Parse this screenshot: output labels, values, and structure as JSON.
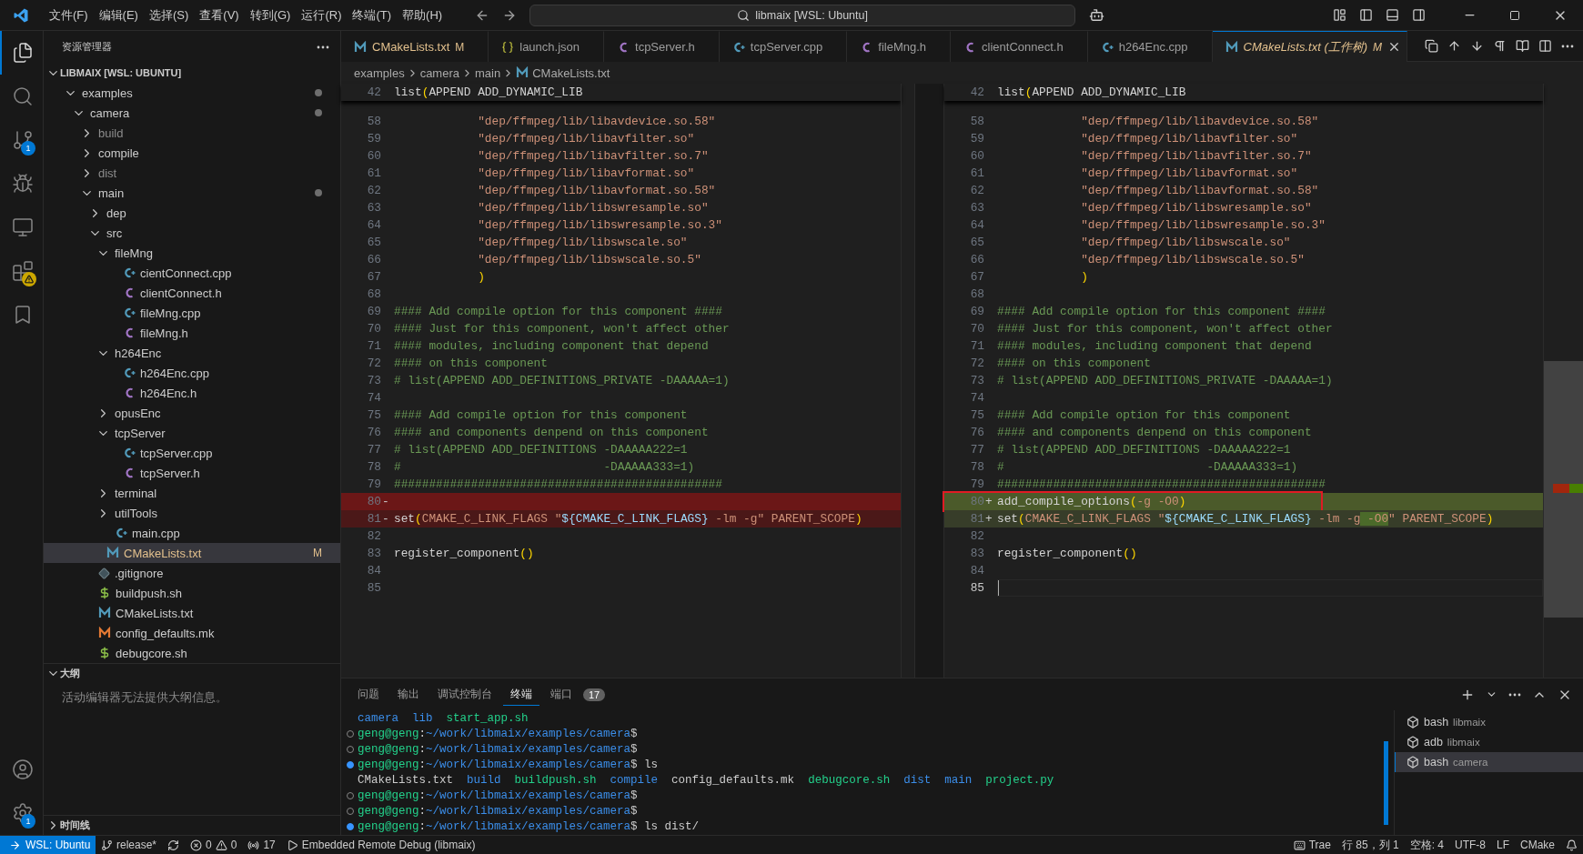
{
  "title_bar": {
    "menus": [
      "文件(F)",
      "编辑(E)",
      "选择(S)",
      "查看(V)",
      "转到(G)",
      "运行(R)",
      "终端(T)",
      "帮助(H)"
    ],
    "search": "libmaix [WSL: Ubuntu]"
  },
  "activity_bar": {
    "top": [
      {
        "selected": true
      },
      {
        "selected": false
      },
      {
        "selected": false,
        "badge": "1"
      },
      {
        "selected": false
      },
      {
        "selected": false
      },
      {
        "selected": false,
        "warning": true
      },
      {
        "selected": false
      }
    ],
    "bottom": [
      {
        "selected": false
      },
      {
        "selected": false,
        "badge": "1"
      }
    ]
  },
  "sidebar": {
    "title": "资源管理器",
    "root": "LIBMAIX [WSL: UBUNTU]",
    "root_expanded": true,
    "tree": [
      {
        "label": "examples",
        "kind": "folder",
        "expanded": true,
        "modified": true,
        "dimmed": false,
        "selected": false,
        "children": [
          {
            "label": "camera",
            "kind": "folder",
            "expanded": true,
            "modified": true,
            "dimmed": false,
            "selected": false,
            "children": [
              {
                "label": "build",
                "kind": "folder",
                "expanded": false,
                "modified": false,
                "dimmed": true,
                "selected": false
              },
              {
                "label": "compile",
                "kind": "folder",
                "expanded": false,
                "modified": false,
                "dimmed": false,
                "selected": false
              },
              {
                "label": "dist",
                "kind": "folder",
                "expanded": false,
                "modified": false,
                "dimmed": true,
                "selected": false
              },
              {
                "label": "main",
                "kind": "folder",
                "expanded": true,
                "modified": true,
                "dimmed": false,
                "selected": false,
                "children": [
                  {
                    "label": "dep",
                    "kind": "folder",
                    "expanded": false,
                    "modified": false,
                    "dimmed": false,
                    "selected": false
                  },
                  {
                    "label": "src",
                    "kind": "folder",
                    "expanded": true,
                    "modified": false,
                    "dimmed": false,
                    "selected": false,
                    "children": [
                      {
                        "label": "fileMng",
                        "kind": "folder",
                        "expanded": true,
                        "modified": false,
                        "dimmed": false,
                        "selected": false,
                        "children": [
                          {
                            "label": "cientConnect.cpp",
                            "kind": "cpp",
                            "modified": false,
                            "dimmed": false,
                            "selected": false
                          },
                          {
                            "label": "clientConnect.h",
                            "kind": "h",
                            "modified": false,
                            "dimmed": false,
                            "selected": false
                          },
                          {
                            "label": "fileMng.cpp",
                            "kind": "cpp",
                            "modified": false,
                            "dimmed": false,
                            "selected": false
                          },
                          {
                            "label": "fileMng.h",
                            "kind": "h",
                            "modified": false,
                            "dimmed": false,
                            "selected": false
                          }
                        ]
                      },
                      {
                        "label": "h264Enc",
                        "kind": "folder",
                        "expanded": true,
                        "modified": false,
                        "dimmed": false,
                        "selected": false,
                        "children": [
                          {
                            "label": "h264Enc.cpp",
                            "kind": "cpp",
                            "modified": false,
                            "dimmed": false,
                            "selected": false
                          },
                          {
                            "label": "h264Enc.h",
                            "kind": "h",
                            "modified": false,
                            "dimmed": false,
                            "selected": false
                          }
                        ]
                      },
                      {
                        "label": "opusEnc",
                        "kind": "folder",
                        "expanded": false,
                        "modified": false,
                        "dimmed": false,
                        "selected": false
                      },
                      {
                        "label": "tcpServer",
                        "kind": "folder",
                        "expanded": true,
                        "modified": false,
                        "dimmed": false,
                        "selected": false,
                        "children": [
                          {
                            "label": "tcpServer.cpp",
                            "kind": "cpp",
                            "modified": false,
                            "dimmed": false,
                            "selected": false
                          },
                          {
                            "label": "tcpServer.h",
                            "kind": "h",
                            "modified": false,
                            "dimmed": false,
                            "selected": false
                          }
                        ]
                      },
                      {
                        "label": "terminal",
                        "kind": "folder",
                        "expanded": false,
                        "modified": false,
                        "dimmed": false,
                        "selected": false
                      },
                      {
                        "label": "utilTools",
                        "kind": "folder",
                        "expanded": false,
                        "modified": false,
                        "dimmed": false,
                        "selected": false
                      },
                      {
                        "label": "main.cpp",
                        "kind": "cpp",
                        "modified": false,
                        "dimmed": false,
                        "selected": false
                      }
                    ]
                  },
                  {
                    "label": "CMakeLists.txt",
                    "kind": "cmake",
                    "modified": true,
                    "badge": "M",
                    "dimmed": false,
                    "selected": true
                  }
                ]
              },
              {
                "label": ".gitignore",
                "kind": "git",
                "modified": false,
                "dimmed": false,
                "selected": false
              },
              {
                "label": "buildpush.sh",
                "kind": "sh",
                "modified": false,
                "dimmed": false,
                "selected": false
              },
              {
                "label": "CMakeLists.txt",
                "kind": "cmake",
                "modified": false,
                "dimmed": false,
                "selected": false
              },
              {
                "label": "config_defaults.mk",
                "kind": "mk",
                "modified": false,
                "dimmed": false,
                "selected": false
              },
              {
                "label": "debugcore.sh",
                "kind": "sh",
                "modified": false,
                "dimmed": false,
                "selected": false
              }
            ]
          }
        ]
      }
    ],
    "outline": {
      "title": "大纲",
      "expanded": true,
      "message": "活动编辑器无法提供大纲信息。"
    },
    "timeline": {
      "title": "时间线",
      "expanded": false
    }
  },
  "tabs": [
    {
      "label": "CMakeLists.txt",
      "kind": "cmake",
      "modified": true,
      "badge": "M",
      "selected": false,
      "preview": false
    },
    {
      "label": "launch.json",
      "kind": "json",
      "modified": false,
      "selected": false,
      "preview": false
    },
    {
      "label": "tcpServer.h",
      "kind": "h",
      "modified": false,
      "selected": false,
      "preview": false
    },
    {
      "label": "tcpServer.cpp",
      "kind": "cpp",
      "modified": false,
      "selected": false,
      "preview": false
    },
    {
      "label": "fileMng.h",
      "kind": "h",
      "modified": false,
      "selected": false,
      "preview": false
    },
    {
      "label": "clientConnect.h",
      "kind": "h",
      "modified": false,
      "selected": false,
      "preview": false
    },
    {
      "label": "h264Enc.cpp",
      "kind": "cpp",
      "modified": false,
      "selected": false,
      "preview": false
    },
    {
      "label": "CMakeLists.txt (工作树)",
      "kind": "cmake",
      "modified": true,
      "badge": "M",
      "selected": true,
      "preview": true
    }
  ],
  "breadcrumb": [
    "examples",
    "camera",
    "main",
    "CMakeLists.txt"
  ],
  "diff": {
    "panes": [
      {
        "sticky": {
          "n": "42",
          "segs": [
            {
              "text": "list",
              "kind": "func"
            },
            {
              "text": "(",
              "kind": "paren"
            },
            {
              "text": "APPEND ADD_DYNAMIC_LIB",
              "kind": "plain"
            }
          ]
        },
        "lines": [
          {
            "n": "58",
            "kind": "unchanged",
            "segs": [
              {
                "text": "            \"dep/ffmpeg/lib/libavdevice.so.58\"",
                "kind": "string"
              }
            ]
          },
          {
            "n": "59",
            "kind": "unchanged",
            "segs": [
              {
                "text": "            \"dep/ffmpeg/lib/libavfilter.so\"",
                "kind": "string"
              }
            ]
          },
          {
            "n": "60",
            "kind": "unchanged",
            "segs": [
              {
                "text": "            \"dep/ffmpeg/lib/libavfilter.so.7\"",
                "kind": "string"
              }
            ]
          },
          {
            "n": "61",
            "kind": "unchanged",
            "segs": [
              {
                "text": "            \"dep/ffmpeg/lib/libavformat.so\"",
                "kind": "string"
              }
            ]
          },
          {
            "n": "62",
            "kind": "unchanged",
            "segs": [
              {
                "text": "            \"dep/ffmpeg/lib/libavformat.so.58\"",
                "kind": "string"
              }
            ]
          },
          {
            "n": "63",
            "kind": "unchanged",
            "segs": [
              {
                "text": "            \"dep/ffmpeg/lib/libswresample.so\"",
                "kind": "string"
              }
            ]
          },
          {
            "n": "64",
            "kind": "unchanged",
            "segs": [
              {
                "text": "            \"dep/ffmpeg/lib/libswresample.so.3\"",
                "kind": "string"
              }
            ]
          },
          {
            "n": "65",
            "kind": "unchanged",
            "segs": [
              {
                "text": "            \"dep/ffmpeg/lib/libswscale.so\"",
                "kind": "string"
              }
            ]
          },
          {
            "n": "66",
            "kind": "unchanged",
            "segs": [
              {
                "text": "            \"dep/ffmpeg/lib/libswscale.so.5\"",
                "kind": "string"
              }
            ]
          },
          {
            "n": "67",
            "kind": "unchanged",
            "segs": [
              {
                "text": "            )",
                "kind": "paren"
              }
            ]
          },
          {
            "n": "68",
            "kind": "unchanged"
          },
          {
            "n": "69",
            "kind": "unchanged",
            "segs": [
              {
                "text": "#### Add compile option for this component ####",
                "kind": "comment"
              }
            ]
          },
          {
            "n": "70",
            "kind": "unchanged",
            "segs": [
              {
                "text": "#### Just for this component, won't affect other",
                "kind": "comment"
              }
            ]
          },
          {
            "n": "71",
            "kind": "unchanged",
            "segs": [
              {
                "text": "#### modules, including component that depend",
                "kind": "comment"
              }
            ]
          },
          {
            "n": "72",
            "kind": "unchanged",
            "segs": [
              {
                "text": "#### on this component",
                "kind": "comment"
              }
            ]
          },
          {
            "n": "73",
            "kind": "unchanged",
            "segs": [
              {
                "text": "# list(APPEND ADD_DEFINITIONS_PRIVATE -DAAAAA=1)",
                "kind": "comment"
              }
            ]
          },
          {
            "n": "74",
            "kind": "unchanged"
          },
          {
            "n": "75",
            "kind": "unchanged",
            "segs": [
              {
                "text": "#### Add compile option for this component",
                "kind": "comment"
              }
            ]
          },
          {
            "n": "76",
            "kind": "unchanged",
            "segs": [
              {
                "text": "#### and components denpend on this component",
                "kind": "comment"
              }
            ]
          },
          {
            "n": "77",
            "kind": "unchanged",
            "segs": [
              {
                "text": "# list(APPEND ADD_DEFINITIONS -DAAAAA222=1",
                "kind": "comment"
              }
            ]
          },
          {
            "n": "78",
            "kind": "unchanged",
            "segs": [
              {
                "text": "#                             -DAAAAA333=1)",
                "kind": "comment"
              }
            ]
          },
          {
            "n": "79",
            "kind": "unchanged",
            "segs": [
              {
                "text": "###############################################",
                "kind": "comment"
              }
            ]
          },
          {
            "n": "80",
            "kind": "removed",
            "marker": "-"
          },
          {
            "n": "81",
            "kind": "modified",
            "marker": "-",
            "segs": [
              {
                "text": "set",
                "kind": "func"
              },
              {
                "text": "(",
                "kind": "paren"
              },
              {
                "text": "CMAKE_C_LINK_FLAGS ",
                "kind": "const"
              },
              {
                "text": "\"",
                "kind": "string"
              },
              {
                "text": "${CMAKE_C_LINK_FLAGS}",
                "kind": "var"
              },
              {
                "text": " -lm -g",
                "kind": "string"
              },
              {
                "text": "\"",
                "kind": "string"
              },
              {
                "text": " PARENT_SCOPE",
                "kind": "const"
              },
              {
                "text": ")",
                "kind": "paren"
              }
            ]
          },
          {
            "n": "82",
            "kind": "unchanged"
          },
          {
            "n": "83",
            "kind": "unchanged",
            "segs": [
              {
                "text": "register_component",
                "kind": "func"
              },
              {
                "text": "()",
                "kind": "paren"
              }
            ]
          },
          {
            "n": "84",
            "kind": "unchanged"
          },
          {
            "n": "85",
            "kind": "unchanged"
          }
        ]
      },
      {
        "sticky": {
          "n": "42",
          "segs": [
            {
              "text": "list",
              "kind": "func"
            },
            {
              "text": "(",
              "kind": "paren"
            },
            {
              "text": "APPEND ADD_DYNAMIC_LIB",
              "kind": "plain"
            }
          ]
        },
        "lines": [
          {
            "n": "58",
            "kind": "unchanged",
            "boxed": false,
            "cursor": false,
            "segs": [
              {
                "text": "            \"dep/ffmpeg/lib/libavdevice.so.58\"",
                "kind": "string"
              }
            ]
          },
          {
            "n": "59",
            "kind": "unchanged",
            "boxed": false,
            "cursor": false,
            "segs": [
              {
                "text": "            \"dep/ffmpeg/lib/libavfilter.so\"",
                "kind": "string"
              }
            ]
          },
          {
            "n": "60",
            "kind": "unchanged",
            "boxed": false,
            "cursor": false,
            "segs": [
              {
                "text": "            \"dep/ffmpeg/lib/libavfilter.so.7\"",
                "kind": "string"
              }
            ]
          },
          {
            "n": "61",
            "kind": "unchanged",
            "boxed": false,
            "cursor": false,
            "segs": [
              {
                "text": "            \"dep/ffmpeg/lib/libavformat.so\"",
                "kind": "string"
              }
            ]
          },
          {
            "n": "62",
            "kind": "unchanged",
            "boxed": false,
            "cursor": false,
            "segs": [
              {
                "text": "            \"dep/ffmpeg/lib/libavformat.so.58\"",
                "kind": "string"
              }
            ]
          },
          {
            "n": "63",
            "kind": "unchanged",
            "boxed": false,
            "cursor": false,
            "segs": [
              {
                "text": "            \"dep/ffmpeg/lib/libswresample.so\"",
                "kind": "string"
              }
            ]
          },
          {
            "n": "64",
            "kind": "unchanged",
            "boxed": false,
            "cursor": false,
            "segs": [
              {
                "text": "            \"dep/ffmpeg/lib/libswresample.so.3\"",
                "kind": "string"
              }
            ]
          },
          {
            "n": "65",
            "kind": "unchanged",
            "boxed": false,
            "cursor": false,
            "segs": [
              {
                "text": "            \"dep/ffmpeg/lib/libswscale.so\"",
                "kind": "string"
              }
            ]
          },
          {
            "n": "66",
            "kind": "unchanged",
            "boxed": false,
            "cursor": false,
            "segs": [
              {
                "text": "            \"dep/ffmpeg/lib/libswscale.so.5\"",
                "kind": "string"
              }
            ]
          },
          {
            "n": "67",
            "kind": "unchanged",
            "boxed": false,
            "cursor": false,
            "segs": [
              {
                "text": "            )",
                "kind": "paren"
              }
            ]
          },
          {
            "n": "68",
            "kind": "unchanged",
            "boxed": false,
            "cursor": false
          },
          {
            "n": "69",
            "kind": "unchanged",
            "boxed": false,
            "cursor": false,
            "segs": [
              {
                "text": "#### Add compile option for this component ####",
                "kind": "comment"
              }
            ]
          },
          {
            "n": "70",
            "kind": "unchanged",
            "boxed": false,
            "cursor": false,
            "segs": [
              {
                "text": "#### Just for this component, won't affect other",
                "kind": "comment"
              }
            ]
          },
          {
            "n": "71",
            "kind": "unchanged",
            "boxed": false,
            "cursor": false,
            "segs": [
              {
                "text": "#### modules, including component that depend",
                "kind": "comment"
              }
            ]
          },
          {
            "n": "72",
            "kind": "unchanged",
            "boxed": false,
            "cursor": false,
            "segs": [
              {
                "text": "#### on this component",
                "kind": "comment"
              }
            ]
          },
          {
            "n": "73",
            "kind": "unchanged",
            "boxed": false,
            "cursor": false,
            "segs": [
              {
                "text": "# list(APPEND ADD_DEFINITIONS_PRIVATE -DAAAAA=1)",
                "kind": "comment"
              }
            ]
          },
          {
            "n": "74",
            "kind": "unchanged",
            "boxed": false,
            "cursor": false
          },
          {
            "n": "75",
            "kind": "unchanged",
            "boxed": false,
            "cursor": false,
            "segs": [
              {
                "text": "#### Add compile option for this component",
                "kind": "comment"
              }
            ]
          },
          {
            "n": "76",
            "kind": "unchanged",
            "boxed": false,
            "cursor": false,
            "segs": [
              {
                "text": "#### and components denpend on this component",
                "kind": "comment"
              }
            ]
          },
          {
            "n": "77",
            "kind": "unchanged",
            "boxed": false,
            "cursor": false,
            "segs": [
              {
                "text": "# list(APPEND ADD_DEFINITIONS -DAAAAA222=1",
                "kind": "comment"
              }
            ]
          },
          {
            "n": "78",
            "kind": "unchanged",
            "boxed": false,
            "cursor": false,
            "segs": [
              {
                "text": "#                             -DAAAAA333=1)",
                "kind": "comment"
              }
            ]
          },
          {
            "n": "79",
            "kind": "unchanged",
            "boxed": false,
            "cursor": false,
            "segs": [
              {
                "text": "###############################################",
                "kind": "comment"
              }
            ]
          },
          {
            "n": "80",
            "kind": "added",
            "boxed": true,
            "cursor": false,
            "marker": "+",
            "segs": [
              {
                "text": "add_compile_options",
                "kind": "func"
              },
              {
                "text": "(",
                "kind": "paren"
              },
              {
                "text": "-g -O0",
                "kind": "const"
              },
              {
                "text": ")",
                "kind": "paren"
              }
            ]
          },
          {
            "n": "81",
            "kind": "modified",
            "boxed": false,
            "cursor": false,
            "marker": "+",
            "segs": [
              {
                "text": "set",
                "kind": "func"
              },
              {
                "text": "(",
                "kind": "paren"
              },
              {
                "text": "CMAKE_C_LINK_FLAGS ",
                "kind": "const"
              },
              {
                "text": "\"",
                "kind": "string"
              },
              {
                "text": "${CMAKE_C_LINK_FLAGS}",
                "kind": "var"
              },
              {
                "text": " -lm -g",
                "kind": "string"
              },
              {
                "text": " -O0",
                "kind": "inserted"
              },
              {
                "text": "\"",
                "kind": "string"
              },
              {
                "text": " PARENT_SCOPE",
                "kind": "const"
              },
              {
                "text": ")",
                "kind": "paren"
              }
            ]
          },
          {
            "n": "82",
            "kind": "unchanged",
            "boxed": false,
            "cursor": false
          },
          {
            "n": "83",
            "kind": "unchanged",
            "boxed": false,
            "cursor": false,
            "segs": [
              {
                "text": "register_component",
                "kind": "func"
              },
              {
                "text": "()",
                "kind": "paren"
              }
            ]
          },
          {
            "n": "84",
            "kind": "unchanged",
            "boxed": false,
            "cursor": false
          },
          {
            "n": "85",
            "kind": "unchanged",
            "boxed": false,
            "cursor": true
          }
        ]
      }
    ]
  },
  "panel": {
    "tabs": [
      {
        "label": "问题",
        "selected": false
      },
      {
        "label": "输出",
        "selected": false
      },
      {
        "label": "调试控制台",
        "selected": false
      },
      {
        "label": "终端",
        "selected": true
      },
      {
        "label": "端口",
        "selected": false,
        "badge": "17"
      }
    ],
    "terminal": [
      {
        "kind": "output",
        "segs": [
          {
            "text": "camera",
            "kind": "dir"
          },
          {
            "text": "  lib",
            "kind": "dir"
          },
          {
            "text": "  start_app.sh",
            "kind": "exec"
          }
        ]
      },
      {
        "kind": "idle",
        "segs": [
          {
            "text": "geng@geng",
            "kind": "user"
          },
          {
            "text": ":",
            "kind": "plain"
          },
          {
            "text": "~/work/libmaix/examples/camera",
            "kind": "path"
          },
          {
            "text": "$",
            "kind": "plain"
          }
        ]
      },
      {
        "kind": "idle",
        "segs": [
          {
            "text": "geng@geng",
            "kind": "user"
          },
          {
            "text": ":",
            "kind": "plain"
          },
          {
            "text": "~/work/libmaix/examples/camera",
            "kind": "path"
          },
          {
            "text": "$",
            "kind": "plain"
          }
        ]
      },
      {
        "kind": "done",
        "segs": [
          {
            "text": "geng@geng",
            "kind": "user"
          },
          {
            "text": ":",
            "kind": "plain"
          },
          {
            "text": "~/work/libmaix/examples/camera",
            "kind": "path"
          },
          {
            "text": "$ ls",
            "kind": "plain"
          }
        ]
      },
      {
        "kind": "output",
        "segs": [
          {
            "text": "CMakeLists.txt",
            "kind": "plain"
          },
          {
            "text": "  build",
            "kind": "dir"
          },
          {
            "text": "  buildpush.sh",
            "kind": "exec"
          },
          {
            "text": "  compile",
            "kind": "dir"
          },
          {
            "text": "  config_defaults.mk",
            "kind": "plain"
          },
          {
            "text": "  debugcore.sh",
            "kind": "exec"
          },
          {
            "text": "  dist",
            "kind": "dir"
          },
          {
            "text": "  main",
            "kind": "dir"
          },
          {
            "text": "  project.py",
            "kind": "exec"
          }
        ]
      },
      {
        "kind": "idle",
        "segs": [
          {
            "text": "geng@geng",
            "kind": "user"
          },
          {
            "text": ":",
            "kind": "plain"
          },
          {
            "text": "~/work/libmaix/examples/camera",
            "kind": "path"
          },
          {
            "text": "$",
            "kind": "plain"
          }
        ]
      },
      {
        "kind": "idle",
        "segs": [
          {
            "text": "geng@geng",
            "kind": "user"
          },
          {
            "text": ":",
            "kind": "plain"
          },
          {
            "text": "~/work/libmaix/examples/camera",
            "kind": "path"
          },
          {
            "text": "$",
            "kind": "plain"
          }
        ]
      },
      {
        "kind": "done",
        "segs": [
          {
            "text": "geng@geng",
            "kind": "user"
          },
          {
            "text": ":",
            "kind": "plain"
          },
          {
            "text": "~/work/libmaix/examples/camera",
            "kind": "path"
          },
          {
            "text": "$ ls dist/",
            "kind": "plain"
          }
        ]
      }
    ],
    "sessions": [
      {
        "shell": "bash",
        "name": "libmaix",
        "selected": false
      },
      {
        "shell": "adb",
        "name": "libmaix",
        "selected": false
      },
      {
        "shell": "bash",
        "name": "camera",
        "selected": true
      }
    ]
  },
  "status_bar": {
    "remote": "WSL: Ubuntu",
    "branch": "release*",
    "errors": "0",
    "warnings": "0",
    "ports": "17",
    "debug": "Embedded Remote Debug (libmaix)",
    "ai": "Trae",
    "position": "行 85，列 1",
    "indent": "空格: 4",
    "encoding": "UTF-8",
    "eol": "LF",
    "language": "CMake"
  }
}
